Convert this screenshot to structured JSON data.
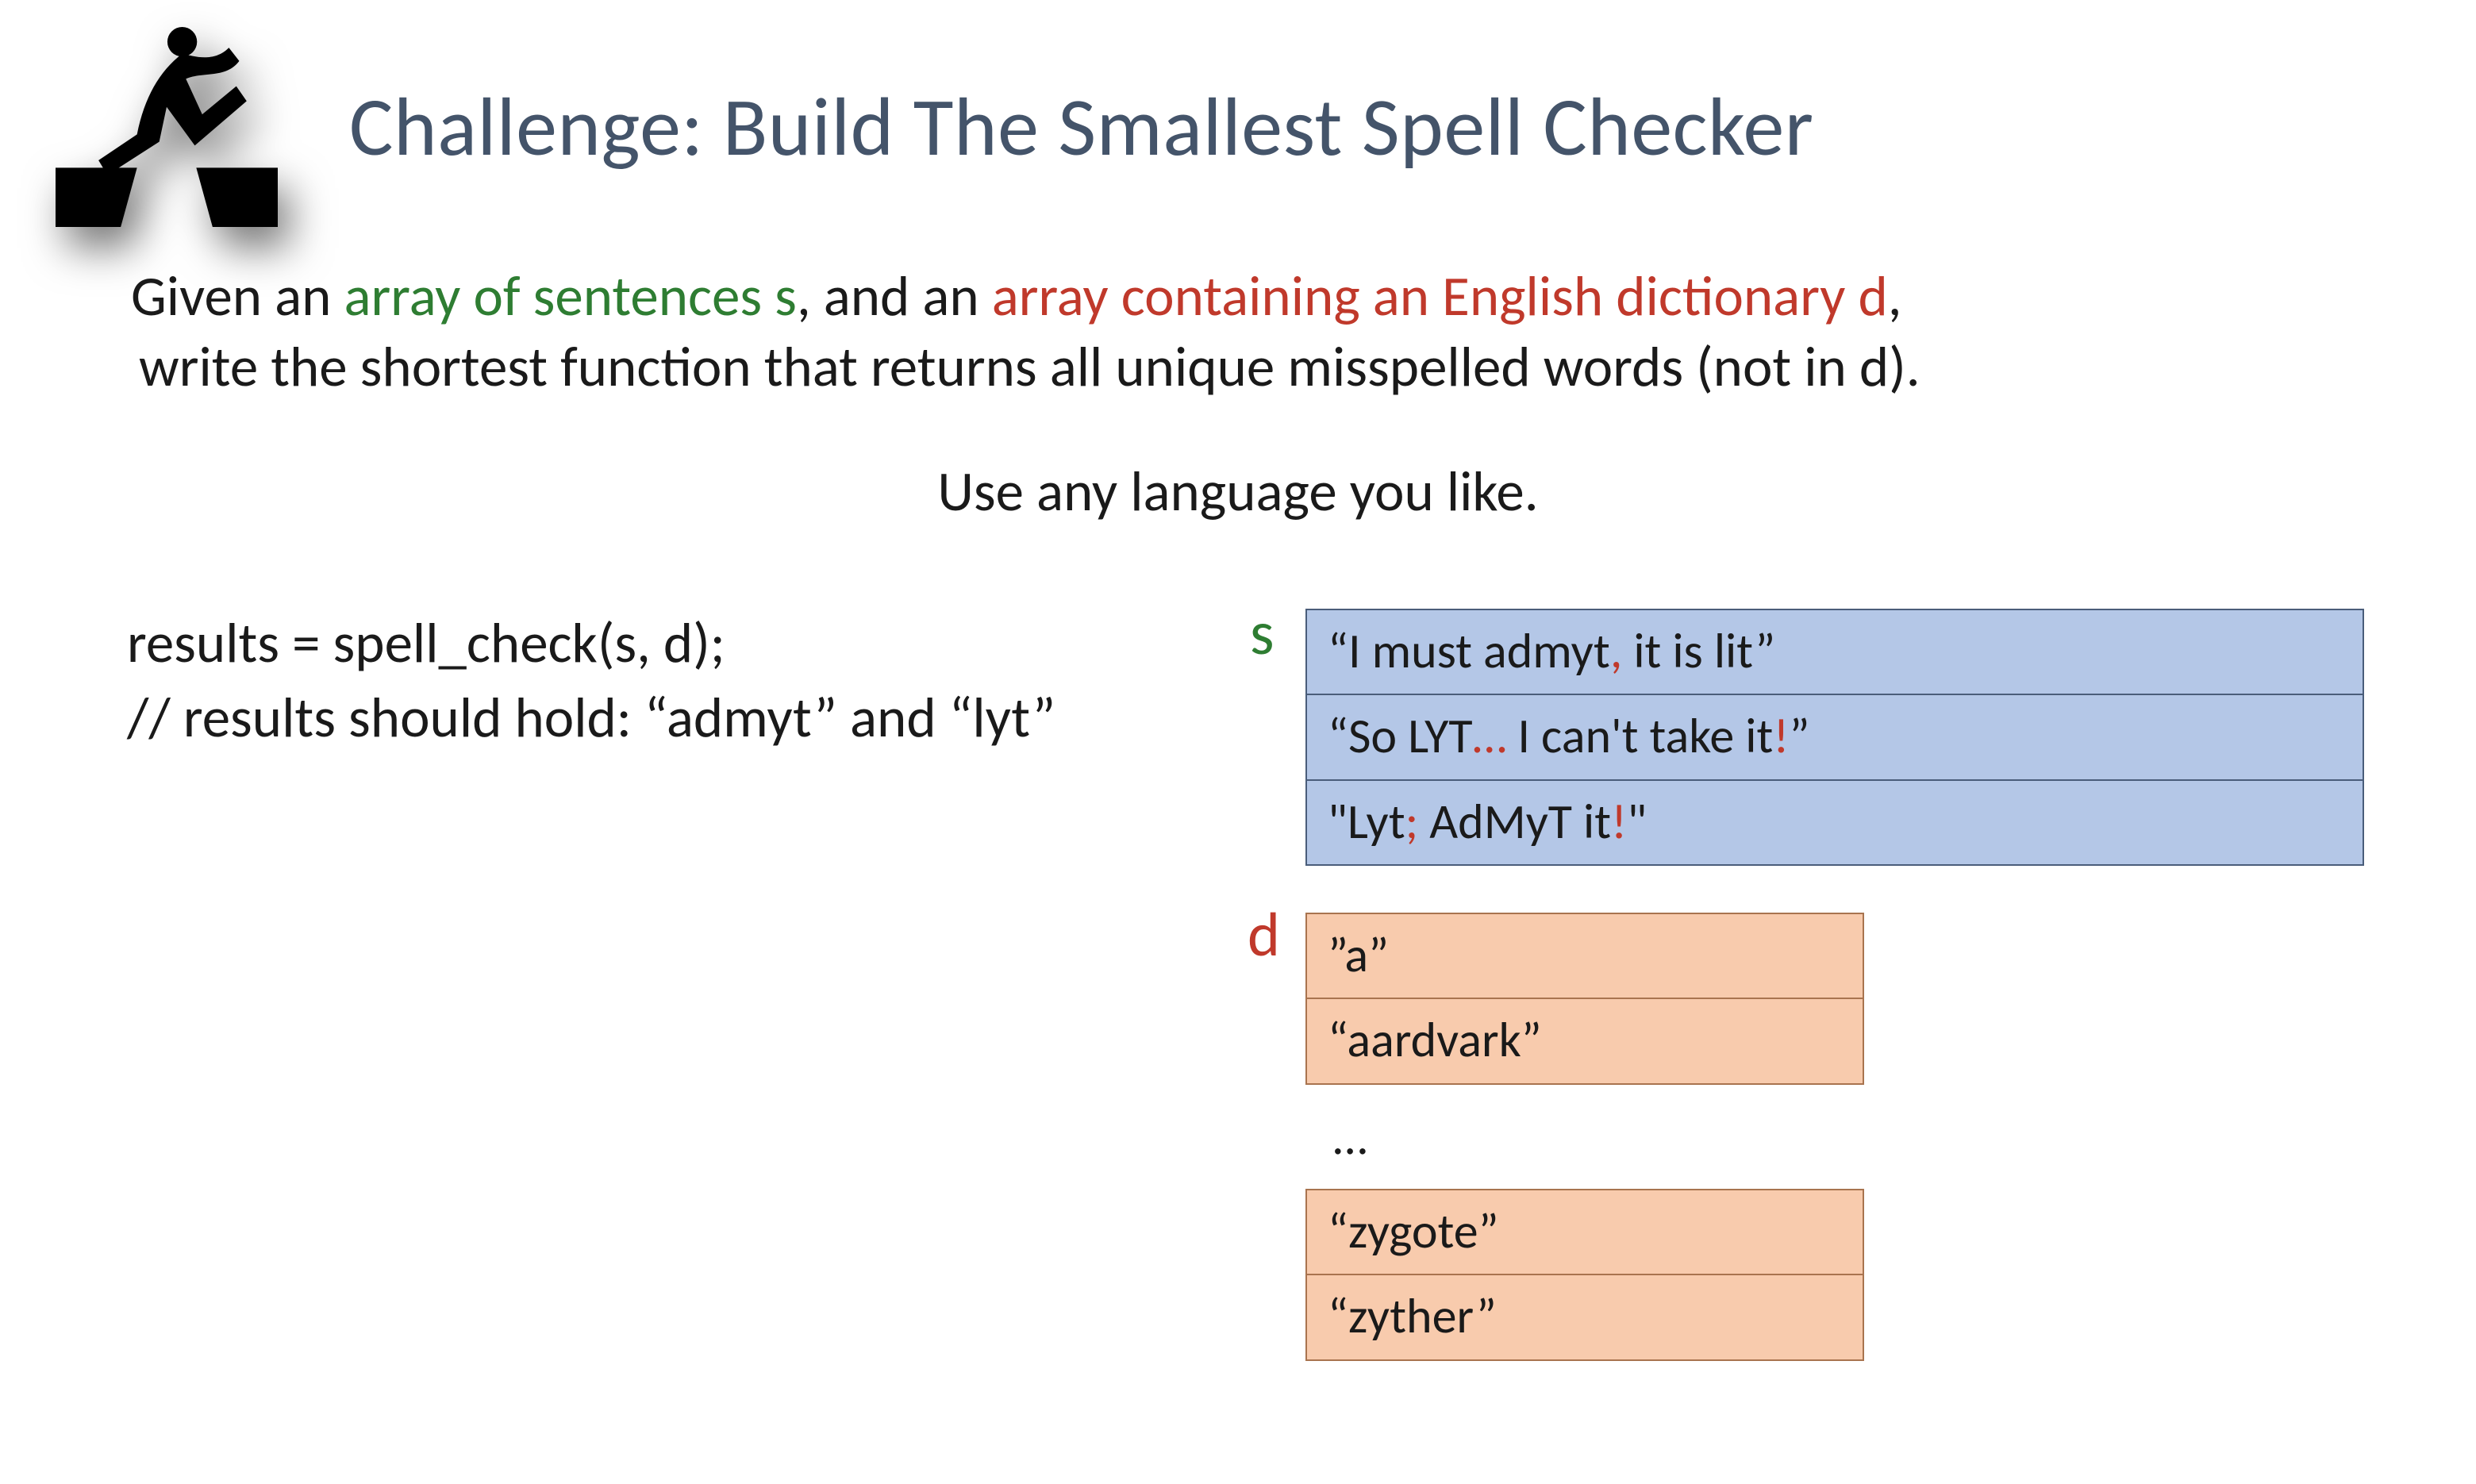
{
  "title": "Challenge: Build The Smallest Spell Checker",
  "prompt": {
    "pre1": "Given an ",
    "green": "array of sentences s",
    "mid1": ", and an ",
    "red": "array containing an English dictionary d",
    "post1": ",",
    "line2": "write the shortest function that returns all unique misspelled words (not in d)."
  },
  "subprompt": "Use any language you like.",
  "code": {
    "line1": "results = spell_check(s, d);",
    "line2": "// results should hold: “admyt” and “lyt”"
  },
  "labels": {
    "s": "s",
    "d": "d"
  },
  "s_rows": {
    "r0": {
      "a": "“I must admyt",
      "p1": ",",
      "b": " it is lit”"
    },
    "r1": {
      "a": "“So LYT",
      "p1": "…",
      "b": " I can't take it",
      "p2": "!",
      "c": "”"
    },
    "r2": {
      "a": "\"Lyt",
      "p1": ";",
      "b": " AdMyT it",
      "p2": "!",
      "c": "\""
    }
  },
  "d_rows_top": {
    "r0": "”a”",
    "r1": "“aardvark”"
  },
  "d_ellipsis": "…",
  "d_rows_bot": {
    "r0": "“zygote”",
    "r1": "“zyther”"
  }
}
